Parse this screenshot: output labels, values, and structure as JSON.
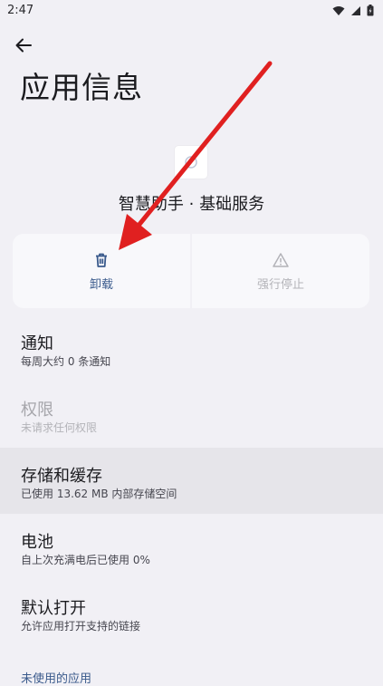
{
  "status_bar": {
    "time": "2:47",
    "icons": [
      "wifi-icon",
      "signal-icon",
      "battery-icon"
    ]
  },
  "header": {
    "back_icon": "arrow-back-icon",
    "title": "应用信息"
  },
  "app": {
    "name": "智慧助手 · 基础服务",
    "icon": "app-icon"
  },
  "actions": [
    {
      "label": "卸载",
      "icon": "trash-icon",
      "enabled": true
    },
    {
      "label": "强行停止",
      "icon": "warning-icon",
      "enabled": false
    }
  ],
  "settings": [
    {
      "title": "通知",
      "summary": "每周大约 0 条通知",
      "enabled": true
    },
    {
      "title": "权限",
      "summary": "未请求任何权限",
      "enabled": false
    },
    {
      "title": "存储和缓存",
      "summary": "已使用 13.62 MB 内部存储空间",
      "enabled": true,
      "highlighted": true
    },
    {
      "title": "电池",
      "summary": "自上次充满电后已使用 0%",
      "enabled": true
    },
    {
      "title": "默认打开",
      "summary": "允许应用打开支持的链接",
      "enabled": true
    }
  ],
  "section": {
    "label": "未使用的应用"
  },
  "colors": {
    "background": "#f1f0f5",
    "accent": "#3a5a8c",
    "arrow": "#e02020"
  }
}
